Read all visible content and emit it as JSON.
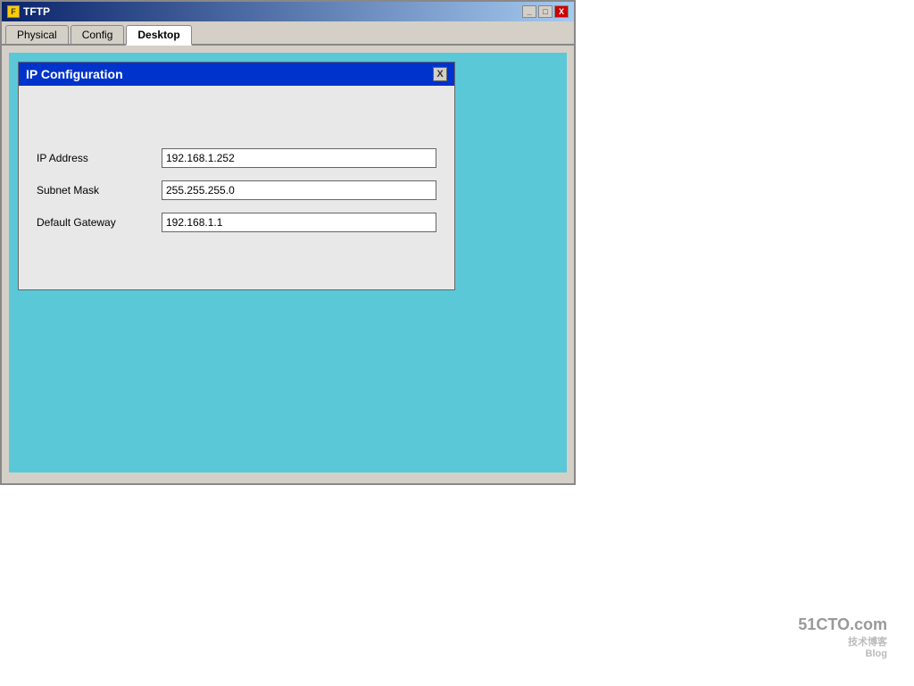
{
  "window": {
    "title": "TFTP",
    "title_icon": "F",
    "minimize_label": "_",
    "maximize_label": "□",
    "close_label": "X"
  },
  "tabs": [
    {
      "id": "physical",
      "label": "Physical",
      "active": false
    },
    {
      "id": "config",
      "label": "Config",
      "active": false
    },
    {
      "id": "desktop",
      "label": "Desktop",
      "active": true
    }
  ],
  "ip_config": {
    "title": "IP Configuration",
    "close_label": "X",
    "fields": [
      {
        "label": "IP Address",
        "value": "192.168.1.252"
      },
      {
        "label": "Subnet Mask",
        "value": "255.255.255.0"
      },
      {
        "label": "Default Gateway",
        "value": "192.168.1.1"
      }
    ]
  },
  "watermark": {
    "site": "51CTO.com",
    "sub1": "技术博客",
    "sub2": "Blog"
  }
}
